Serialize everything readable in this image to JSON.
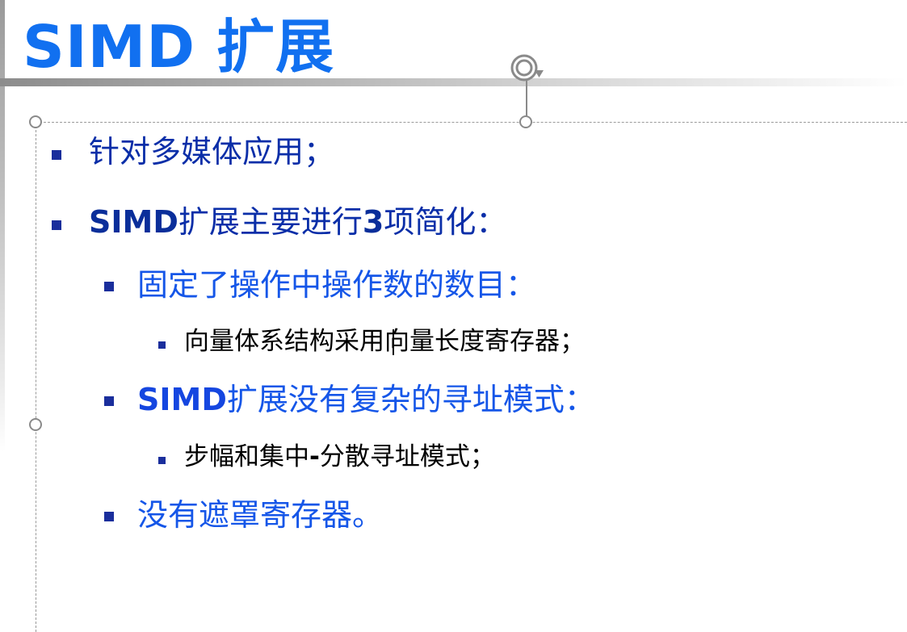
{
  "slide": {
    "title": "SIMD 扩展",
    "bullets": {
      "b1": {
        "text": "针对多媒体应用；"
      },
      "b2": {
        "bold": "SIMD",
        "text": "扩展主要进行",
        "bold2": "3",
        "text2": "项简化："
      },
      "b2_1": {
        "text": "固定了操作中操作数的数目："
      },
      "b2_1_1": {
        "text": "向量体系结构采用向量长度寄存器；"
      },
      "b2_2": {
        "bold": "SIMD",
        "text": "扩展没有复杂的寻址模式："
      },
      "b2_2_1": {
        "text1": "步幅和集中",
        "bold": "-",
        "text2": "分散寻址模式；"
      },
      "b2_3": {
        "text": "没有遮罩寄存器。"
      }
    }
  },
  "colors": {
    "title": "#1170f0",
    "level1": "#0a2ea8",
    "level2": "#1556e8",
    "level3": "#000000",
    "bullet": "#1a2e9c"
  },
  "icons": {
    "rotate_handle": "rotate-icon",
    "resize_handles": "resize-handle"
  }
}
